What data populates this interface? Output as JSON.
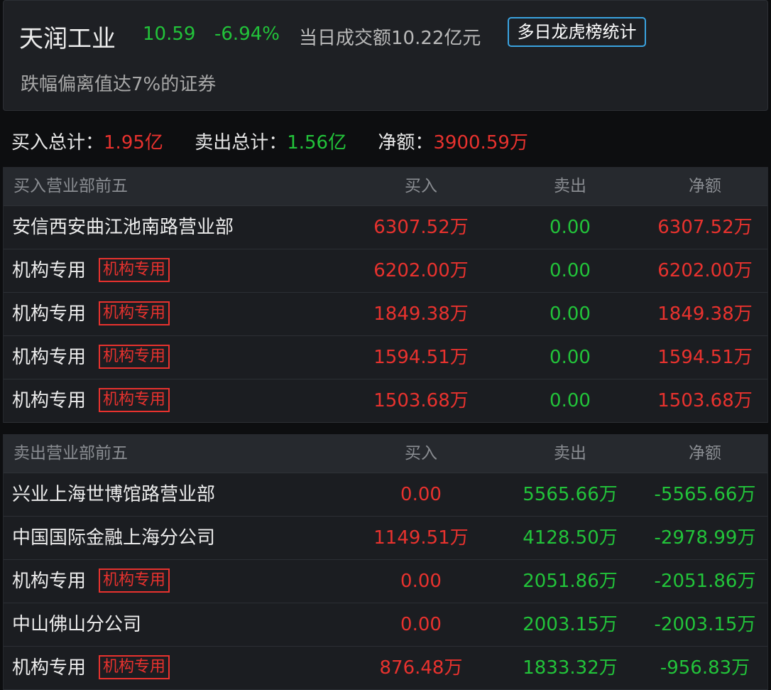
{
  "header": {
    "stock_name": "天润工业",
    "price": "10.59",
    "change_pct": "-6.94%",
    "turnover": "当日成交额10.22亿元",
    "stats_button": "多日龙虎榜统计",
    "reason": "跌幅偏离值达7%的证券"
  },
  "summary": {
    "buy_label": "买入总计：",
    "buy_value": "1.95亿",
    "sell_label": "卖出总计：",
    "sell_value": "1.56亿",
    "net_label": "净额：",
    "net_value": "3900.59万"
  },
  "buy_table": {
    "title": "买入营业部前五",
    "columns": [
      "买入",
      "卖出",
      "净额"
    ],
    "rows": [
      {
        "name": "安信西安曲江池南路营业部",
        "tag": "",
        "buy": "6307.52万",
        "sell": "0.00",
        "net": "6307.52万"
      },
      {
        "name": "机构专用",
        "tag": "机构专用",
        "buy": "6202.00万",
        "sell": "0.00",
        "net": "6202.00万"
      },
      {
        "name": "机构专用",
        "tag": "机构专用",
        "buy": "1849.38万",
        "sell": "0.00",
        "net": "1849.38万"
      },
      {
        "name": "机构专用",
        "tag": "机构专用",
        "buy": "1594.51万",
        "sell": "0.00",
        "net": "1594.51万"
      },
      {
        "name": "机构专用",
        "tag": "机构专用",
        "buy": "1503.68万",
        "sell": "0.00",
        "net": "1503.68万"
      }
    ]
  },
  "sell_table": {
    "title": "卖出营业部前五",
    "columns": [
      "买入",
      "卖出",
      "净额"
    ],
    "rows": [
      {
        "name": "兴业上海世博馆路营业部",
        "tag": "",
        "buy": "0.00",
        "sell": "5565.66万",
        "net": "-5565.66万"
      },
      {
        "name": "中国国际金融上海分公司",
        "tag": "",
        "buy": "1149.51万",
        "sell": "4128.50万",
        "net": "-2978.99万"
      },
      {
        "name": "机构专用",
        "tag": "机构专用",
        "buy": "0.00",
        "sell": "2051.86万",
        "net": "-2051.86万"
      },
      {
        "name": "中山佛山分公司",
        "tag": "",
        "buy": "0.00",
        "sell": "2003.15万",
        "net": "-2003.15万"
      },
      {
        "name": "机构专用",
        "tag": "机构专用",
        "buy": "876.48万",
        "sell": "1833.32万",
        "net": "-956.83万"
      }
    ]
  },
  "colors": {
    "up": "#e8322e",
    "down": "#22c33a",
    "accent": "#3aa3e0"
  }
}
